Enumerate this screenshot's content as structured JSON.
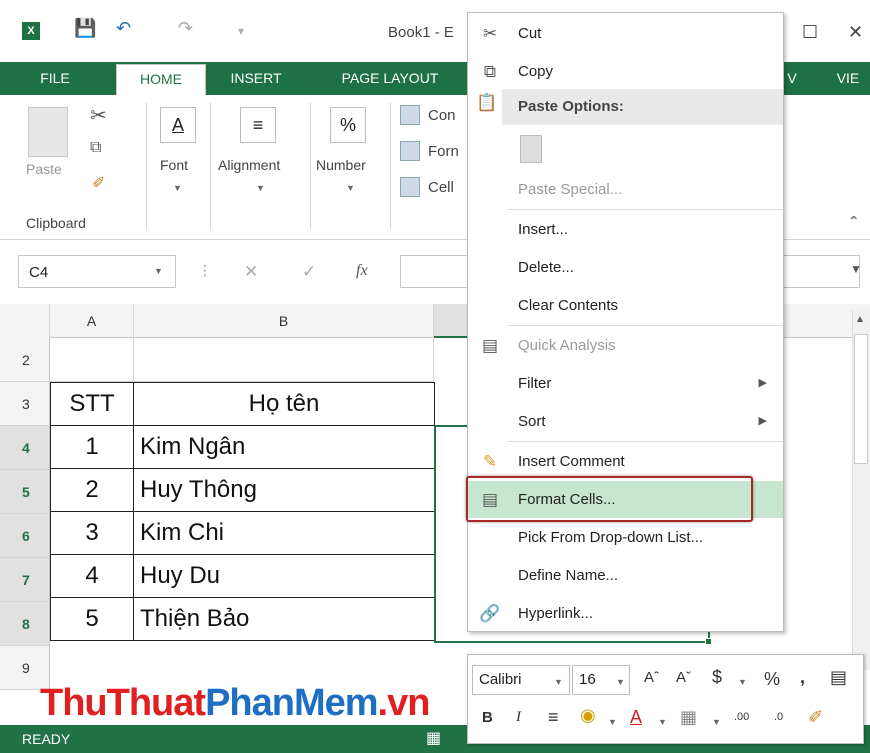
{
  "title": {
    "app_icon": "X",
    "book": "Book1 - E"
  },
  "tabs": [
    "FILE",
    "HOME",
    "INSERT",
    "PAGE LAYOUT",
    "V",
    "VIE"
  ],
  "ribbon": {
    "paste": "Paste",
    "clipboard": "Clipboard",
    "font": "Font",
    "alignment": "Alignment",
    "number": "Number",
    "number_symbol": "%",
    "styles": [
      "Con",
      "Forn",
      "Cell"
    ]
  },
  "formula_bar": {
    "name_box": "C4",
    "fx": "fx"
  },
  "columns": [
    "A",
    "B"
  ],
  "rows": [
    {
      "num": "2",
      "stt": "",
      "name": ""
    },
    {
      "num": "3",
      "stt": "STT",
      "name": "Họ tên"
    },
    {
      "num": "4",
      "stt": "1",
      "name": "Kim Ngân"
    },
    {
      "num": "5",
      "stt": "2",
      "name": "Huy Thông"
    },
    {
      "num": "6",
      "stt": "3",
      "name": "Kim Chi"
    },
    {
      "num": "7",
      "stt": "4",
      "name": "Huy Du"
    },
    {
      "num": "8",
      "stt": "5",
      "name": "Thiện Bảo"
    },
    {
      "num": "9",
      "stt": "",
      "name": ""
    }
  ],
  "watermark": {
    "part1": "ThuThuat",
    "part2": "PhanMem",
    "part3": ".vn"
  },
  "status": "READY",
  "context_menu": {
    "cut": "Cut",
    "copy": "Copy",
    "paste_options": "Paste Options:",
    "paste_special": "Paste Special...",
    "insert": "Insert...",
    "delete": "Delete...",
    "clear_contents": "Clear Contents",
    "quick_analysis": "Quick Analysis",
    "filter": "Filter",
    "sort": "Sort",
    "insert_comment": "Insert Comment",
    "format_cells": "Format Cells...",
    "pick_list": "Pick From Drop-down List...",
    "define_name": "Define Name...",
    "hyperlink": "Hyperlink..."
  },
  "mini_toolbar": {
    "font": "Calibri",
    "size": "16",
    "currency": "$",
    "percent": "%",
    "comma": ",",
    "bold": "B",
    "italic": "I",
    "inc_dec": ".00",
    "dec_dec": ".0"
  }
}
